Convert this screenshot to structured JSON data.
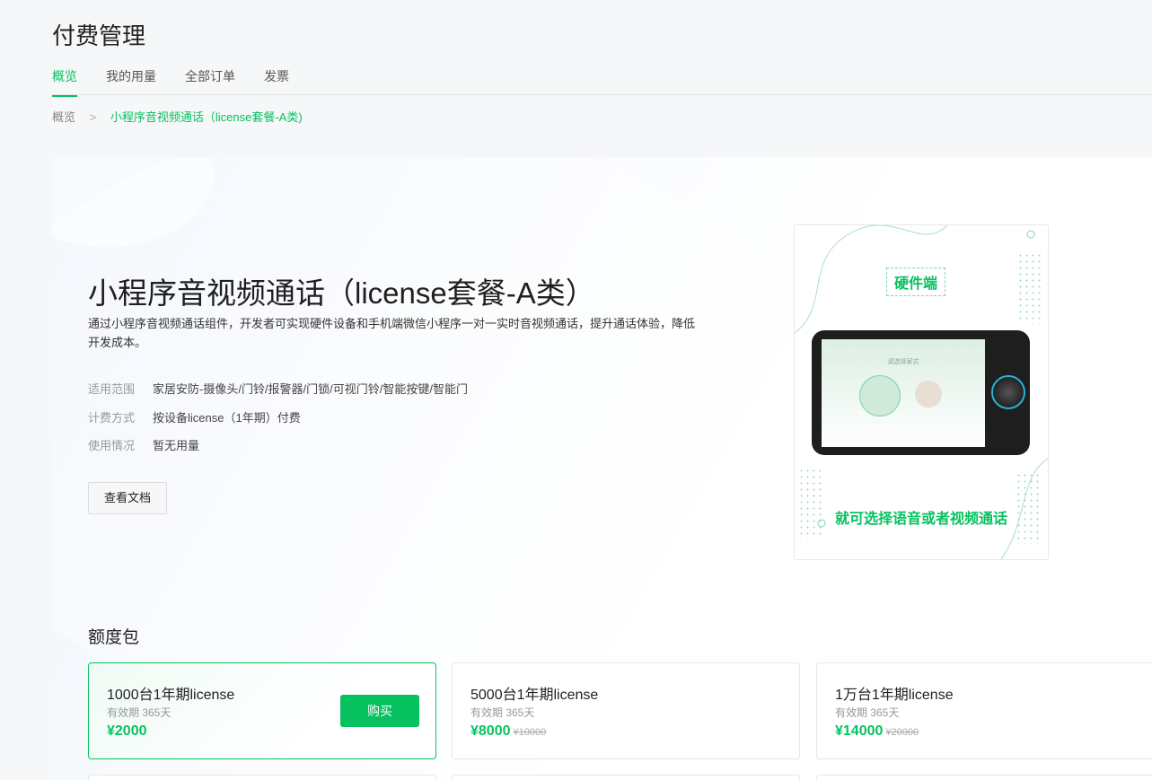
{
  "page": {
    "title": "付费管理"
  },
  "tabs": [
    {
      "label": "概览",
      "active": true
    },
    {
      "label": "我的用量",
      "active": false
    },
    {
      "label": "全部订单",
      "active": false
    },
    {
      "label": "发票",
      "active": false
    }
  ],
  "breadcrumb": {
    "root": "概览",
    "separator": ">",
    "current": "小程序音视频通话（license套餐-A类)"
  },
  "product": {
    "title": "小程序音视频通话（license套餐-A类）",
    "description": "通过小程序音视频通话组件，开发者可实现硬件设备和手机端微信小程序一对一实时音视频通话，提升通话体验，降低开发成本。",
    "meta": [
      {
        "key": "适用范围",
        "value": "家居安防-摄像头/门铃/报警器/门锁/可视门铃/智能按键/智能门"
      },
      {
        "key": "计费方式",
        "value": "按设备license（1年期）付费"
      },
      {
        "key": "使用情况",
        "value": "暂无用量"
      }
    ],
    "doc_button": "查看文档"
  },
  "promo": {
    "tag": "硬件端",
    "screen_text": "请选择家式",
    "caption": "就可选择语音或者视频通话"
  },
  "quota": {
    "section_title": "额度包",
    "buy_label": "购买",
    "packages": [
      {
        "name": "1000台1年期license",
        "validity": "有效期 365天",
        "price": "¥2000",
        "original": "",
        "selected": true
      },
      {
        "name": "5000台1年期license",
        "validity": "有效期 365天",
        "price": "¥8000",
        "original": "¥10000",
        "selected": false
      },
      {
        "name": "1万台1年期license",
        "validity": "有效期 365天",
        "price": "¥14000",
        "original": "¥20000",
        "selected": false
      }
    ]
  },
  "colors": {
    "accent": "#07c160",
    "background": "#f6f7f8"
  }
}
